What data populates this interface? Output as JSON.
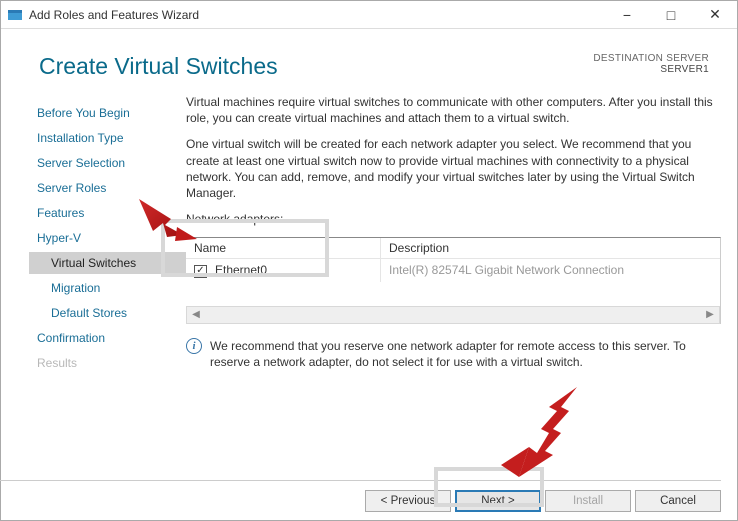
{
  "window": {
    "title": "Add Roles and Features Wizard"
  },
  "header": {
    "title": "Create Virtual Switches",
    "dest_label": "DESTINATION SERVER",
    "dest_value": "SERVER1"
  },
  "nav": {
    "items": [
      {
        "label": "Before You Begin"
      },
      {
        "label": "Installation Type"
      },
      {
        "label": "Server Selection"
      },
      {
        "label": "Server Roles"
      },
      {
        "label": "Features"
      },
      {
        "label": "Hyper-V"
      },
      {
        "label": "Virtual Switches",
        "sub": true,
        "active": true
      },
      {
        "label": "Migration",
        "sub": true
      },
      {
        "label": "Default Stores",
        "sub": true
      },
      {
        "label": "Confirmation"
      },
      {
        "label": "Results",
        "disabled": true
      }
    ]
  },
  "content": {
    "p1": "Virtual machines require virtual switches to communicate with other computers. After you install this role, you can create virtual machines and attach them to a virtual switch.",
    "p2": "One virtual switch will be created for each network adapter you select. We recommend that you create at least one virtual switch now to provide virtual machines with connectivity to a physical network. You can add, remove, and modify your virtual switches later by using the Virtual Switch Manager.",
    "adapters_label": "Network adapters:",
    "col_name": "Name",
    "col_desc": "Description",
    "row": {
      "name": "Ethernet0",
      "desc": "Intel(R) 82574L Gigabit Network Connection",
      "checked": true
    },
    "info": "We recommend that you reserve one network adapter for remote access to this server. To reserve a network adapter, do not select it for use with a virtual switch."
  },
  "footer": {
    "previous": "< Previous",
    "next": "Next >",
    "install": "Install",
    "cancel": "Cancel"
  }
}
